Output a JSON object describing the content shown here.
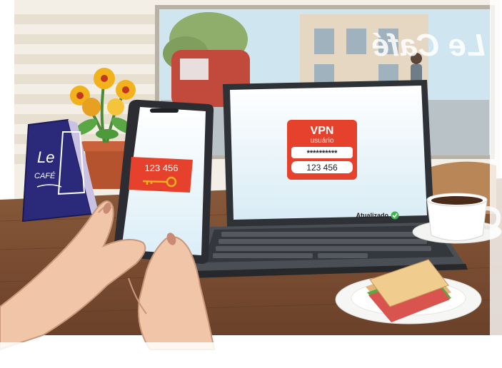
{
  "cafe_sign": {
    "line1": "Le",
    "line2": "CAFÉ"
  },
  "phone": {
    "code": "123 456",
    "icon": "key-icon"
  },
  "laptop": {
    "vpn_title": "VPN",
    "vpn_subtitle": "usuário",
    "password_mask": "**********",
    "code": "123 456",
    "status_text": "Atualizado",
    "status_icon": "check-circle-icon"
  },
  "colors": {
    "accent_red": "#e5412c",
    "status_green": "#3bb54a",
    "sign_blue": "#2b2a7a"
  }
}
